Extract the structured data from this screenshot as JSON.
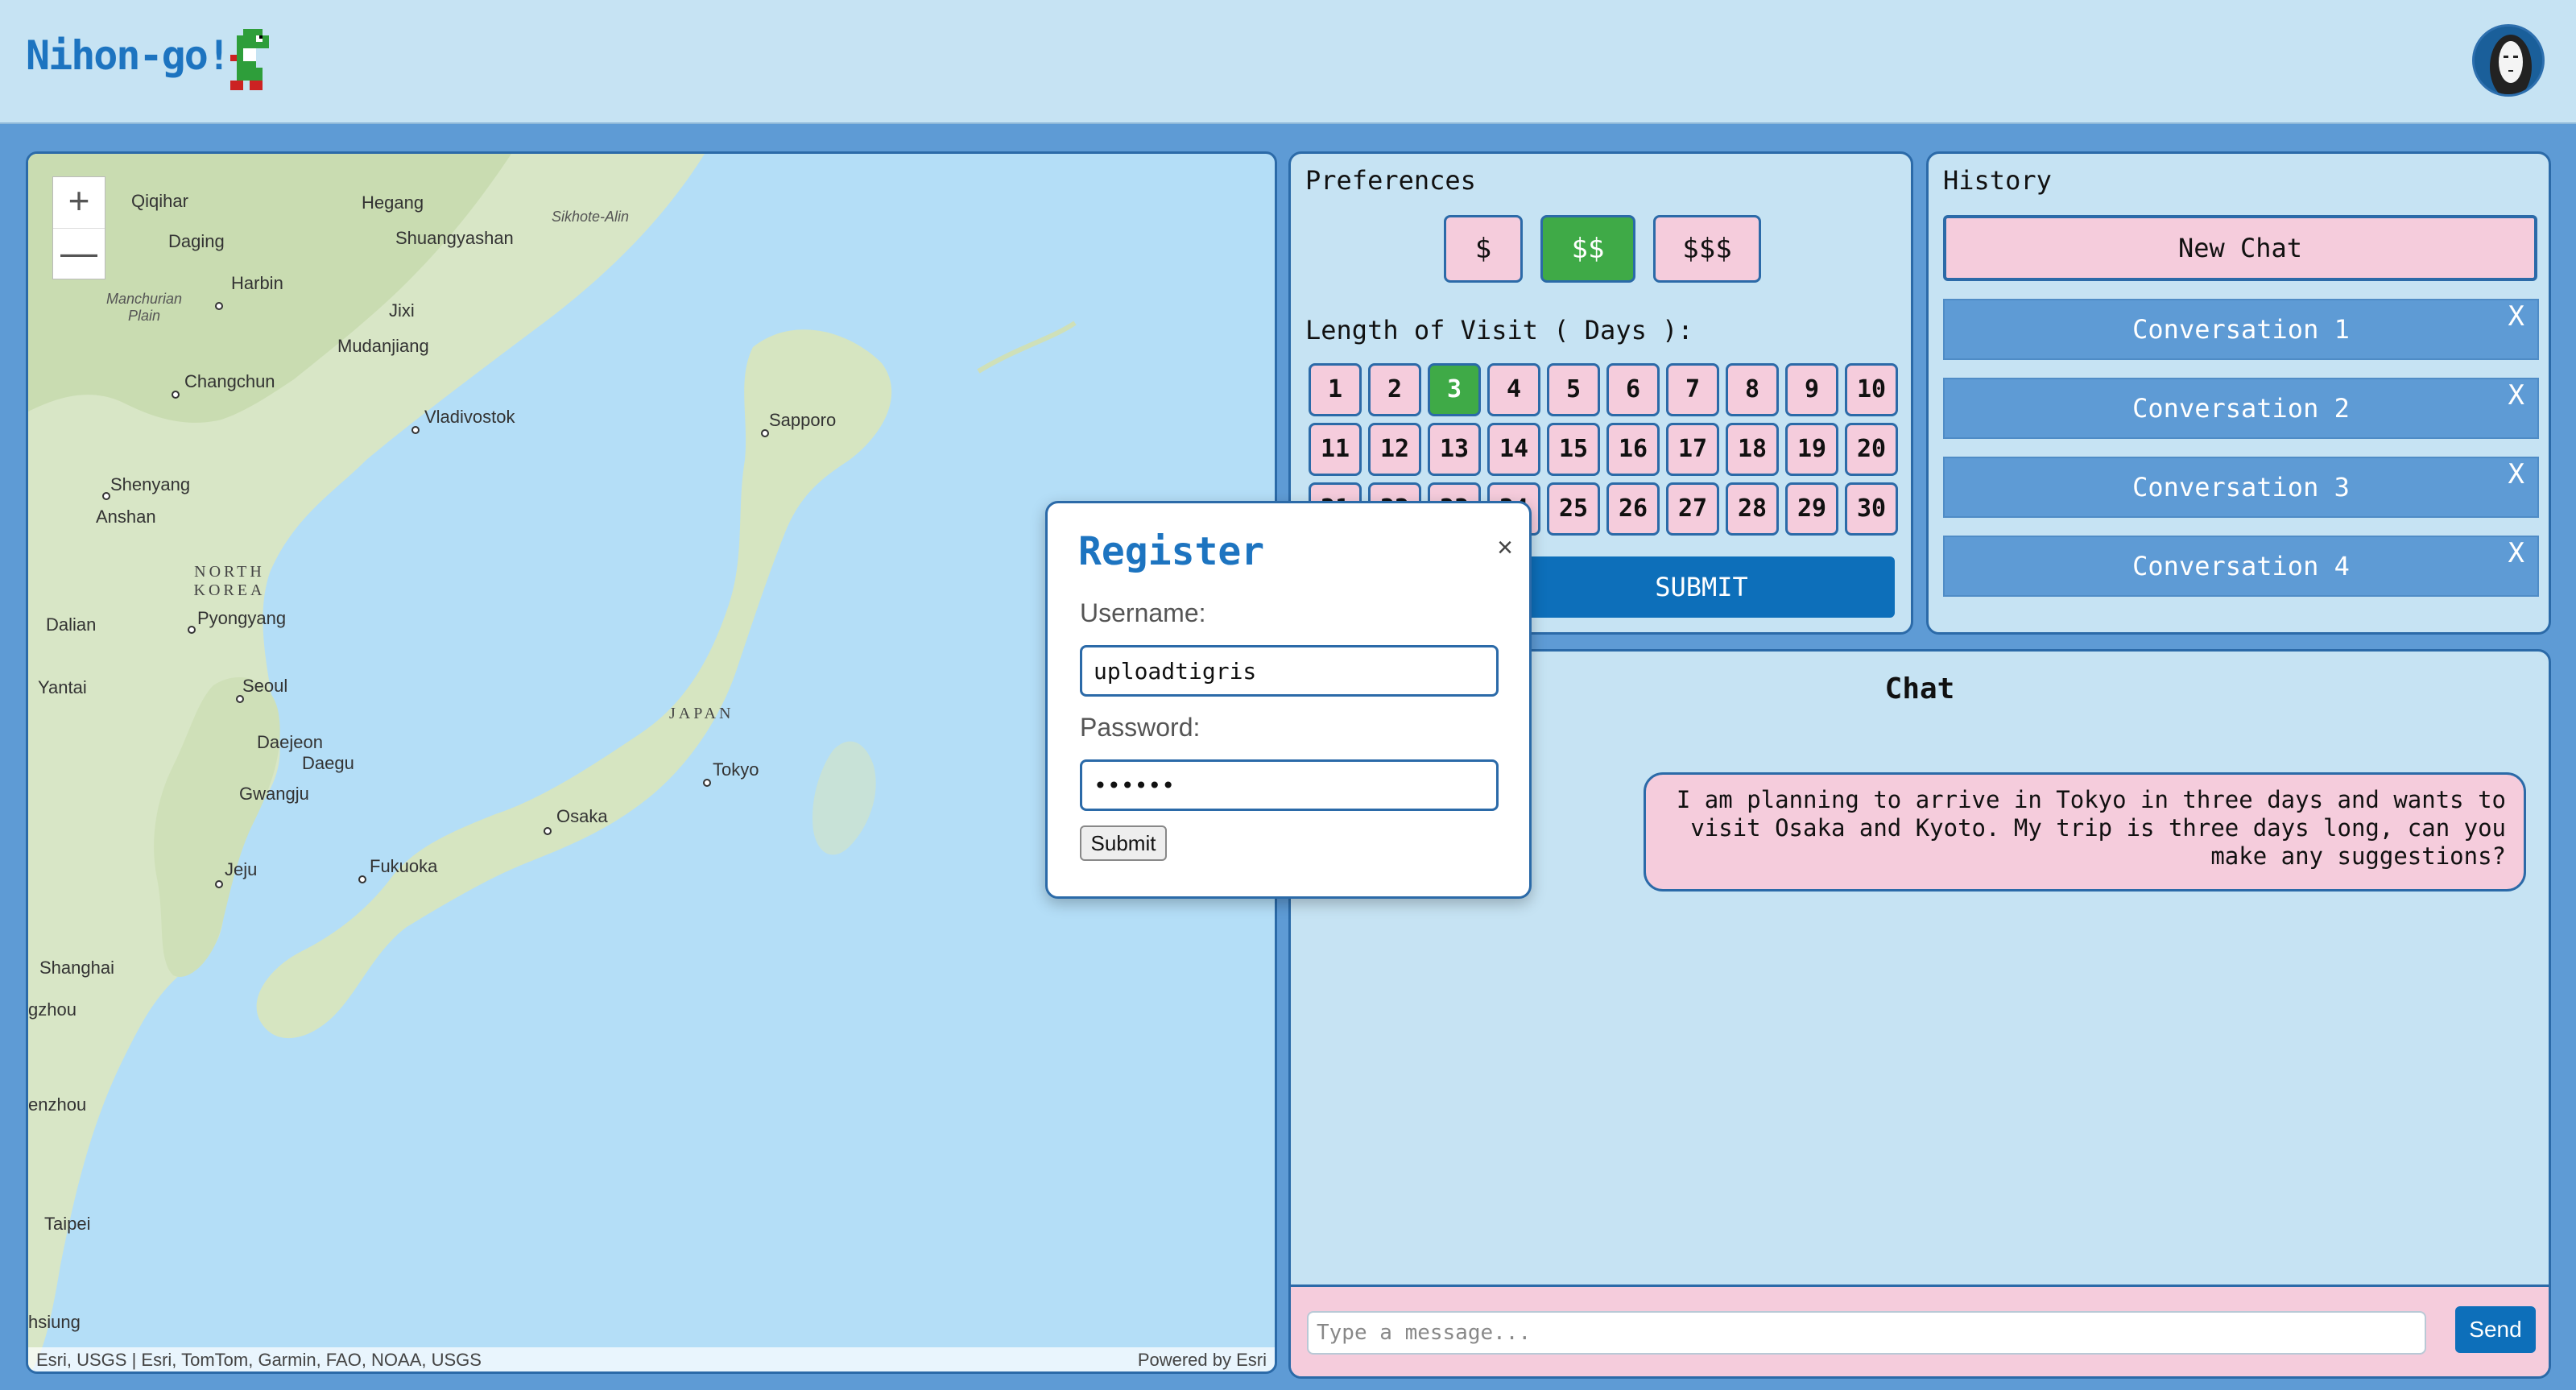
{
  "header": {
    "brand": "Nihon-go!"
  },
  "map": {
    "zoom_in": "+",
    "zoom_out": "—",
    "labels": [
      "Qiqihar",
      "Hegang",
      "Sikhote-Alin",
      "Daging",
      "Shuangyashan",
      "Manchurian Plain",
      "Harbin",
      "Jixi",
      "Mudanjiang",
      "Changchun",
      "Vladivostok",
      "Sapporo",
      "Shenyang",
      "Anshan",
      "NORTH KOREA",
      "Dalian",
      "Pyongyang",
      "Yantai",
      "Seoul",
      "JAPAN",
      "Daejeon",
      "Daegu",
      "Tokyo",
      "Gwangju",
      "Osaka",
      "Jeju",
      "Fukuoka",
      "Shanghai",
      "gzhou",
      "enzhou",
      "Taipei",
      "hsiung"
    ],
    "attribution": "Esri, USGS | Esri, TomTom, Garmin, FAO, NOAA, USGS",
    "powered_by": "Powered by Esri"
  },
  "preferences": {
    "title": "Preferences",
    "price_options": [
      "$",
      "$$",
      "$$$"
    ],
    "selected_price": "$$",
    "length_label": "Length of Visit ( Days ):",
    "days": [
      "1",
      "2",
      "3",
      "4",
      "5",
      "6",
      "7",
      "8",
      "9",
      "10",
      "11",
      "12",
      "13",
      "14",
      "15",
      "16",
      "17",
      "18",
      "19",
      "20",
      "21",
      "22",
      "23",
      "24",
      "25",
      "26",
      "27",
      "28",
      "29",
      "30"
    ],
    "selected_day": "3",
    "submit_label": "SUBMIT"
  },
  "history": {
    "title": "History",
    "new_chat_label": "New Chat",
    "conversations": [
      "Conversation 1",
      "Conversation 2",
      "Conversation 3",
      "Conversation 4"
    ],
    "close_glyph": "X"
  },
  "chat": {
    "title": "Chat",
    "messages": [
      "I am planning to arrive in Tokyo in three days and wants to visit Osaka and Kyoto. My trip is three days long, can you make any suggestions?"
    ],
    "input_placeholder": "Type a message...",
    "send_label": "Send"
  },
  "register_modal": {
    "title": "Register",
    "close_glyph": "×",
    "username_label": "Username:",
    "username_value": "uploadtigris",
    "password_label": "Password:",
    "password_value": "••••••",
    "submit_label": "Submit"
  },
  "colors": {
    "accent_blue": "#1d74c0",
    "panel_bg": "#c6e3f3",
    "pink": "#f5ccdc",
    "active_green": "#3faa47",
    "page_bg": "#5e9bd5"
  }
}
